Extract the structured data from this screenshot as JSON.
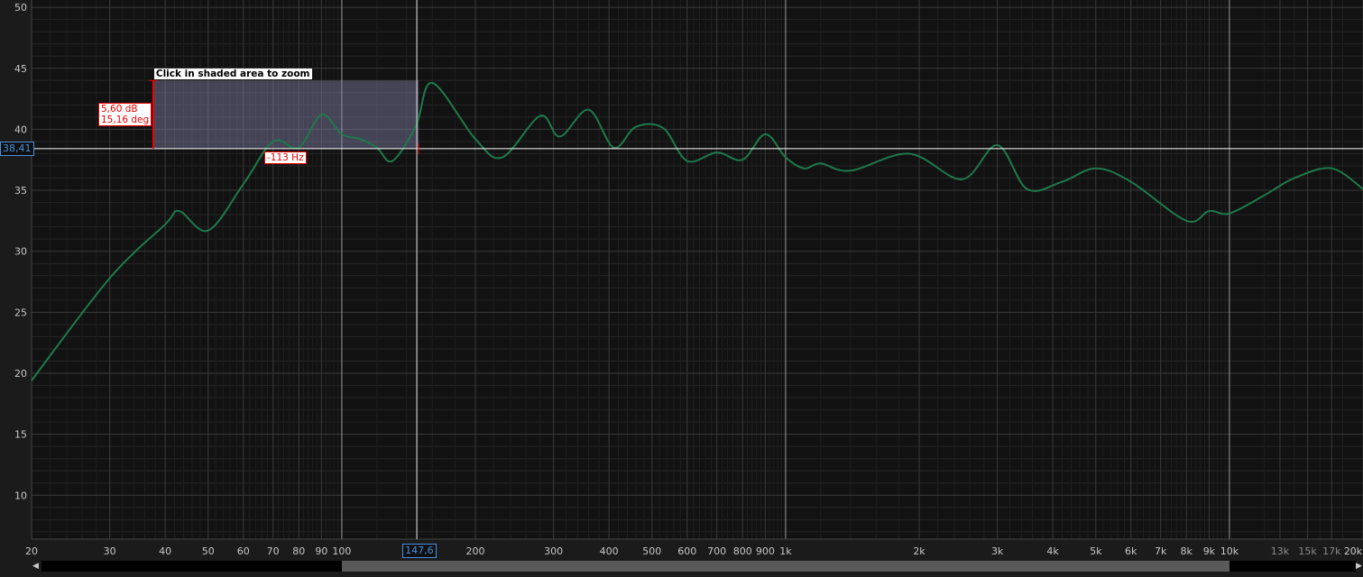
{
  "chart_data": {
    "type": "line",
    "x_scale": "log",
    "xlim": [
      20,
      20000
    ],
    "ylim": [
      6.4,
      50.6
    ],
    "grid": true,
    "y_ticks": [
      10,
      15,
      20,
      25,
      30,
      35,
      40,
      45,
      50
    ],
    "x_ticks": [
      {
        "v": 20,
        "label": "20"
      },
      {
        "v": 30,
        "label": "30"
      },
      {
        "v": 40,
        "label": "40"
      },
      {
        "v": 50,
        "label": "50"
      },
      {
        "v": 60,
        "label": "60"
      },
      {
        "v": 70,
        "label": "70"
      },
      {
        "v": 80,
        "label": "80"
      },
      {
        "v": 90,
        "label": "90"
      },
      {
        "v": 100,
        "label": "100"
      },
      {
        "v": 200,
        "label": "200"
      },
      {
        "v": 300,
        "label": "300"
      },
      {
        "v": 400,
        "label": "400"
      },
      {
        "v": 500,
        "label": "500"
      },
      {
        "v": 600,
        "label": "600"
      },
      {
        "v": 700,
        "label": "700"
      },
      {
        "v": 800,
        "label": "800"
      },
      {
        "v": 900,
        "label": "900"
      },
      {
        "v": 1000,
        "label": "1k"
      },
      {
        "v": 2000,
        "label": "2k"
      },
      {
        "v": 3000,
        "label": "3k"
      },
      {
        "v": 4000,
        "label": "4k"
      },
      {
        "v": 5000,
        "label": "5k"
      },
      {
        "v": 6000,
        "label": "6k"
      },
      {
        "v": 7000,
        "label": "7k"
      },
      {
        "v": 8000,
        "label": "8k"
      },
      {
        "v": 9000,
        "label": "9k"
      },
      {
        "v": 10000,
        "label": "10k"
      },
      {
        "v": 13000,
        "label": "13k",
        "dim": true
      },
      {
        "v": 15000,
        "label": "15k",
        "dim": true
      },
      {
        "v": 17000,
        "label": "17k",
        "dim": true
      },
      {
        "v": 20000,
        "label": "20k"
      }
    ],
    "series": [
      {
        "color": "#1e7a4a",
        "points": [
          [
            20,
            19.4
          ],
          [
            30,
            27.8
          ],
          [
            40,
            32.2
          ],
          [
            43,
            33.3
          ],
          [
            50,
            31.7
          ],
          [
            60,
            35.5
          ],
          [
            70,
            39.0
          ],
          [
            80,
            38.5
          ],
          [
            90,
            41.2
          ],
          [
            100,
            39.6
          ],
          [
            110,
            39.2
          ],
          [
            120,
            38.5
          ],
          [
            130,
            37.4
          ],
          [
            147,
            40.3
          ],
          [
            160,
            43.8
          ],
          [
            200,
            39.2
          ],
          [
            230,
            37.7
          ],
          [
            280,
            41.1
          ],
          [
            310,
            39.4
          ],
          [
            360,
            41.6
          ],
          [
            410,
            38.5
          ],
          [
            460,
            40.2
          ],
          [
            530,
            40.1
          ],
          [
            600,
            37.4
          ],
          [
            700,
            38.1
          ],
          [
            800,
            37.5
          ],
          [
            900,
            39.6
          ],
          [
            1000,
            37.7
          ],
          [
            1100,
            36.8
          ],
          [
            1200,
            37.2
          ],
          [
            1400,
            36.6
          ],
          [
            1900,
            38.0
          ],
          [
            2500,
            35.9
          ],
          [
            3000,
            38.7
          ],
          [
            3500,
            35.1
          ],
          [
            4200,
            35.7
          ],
          [
            5000,
            36.8
          ],
          [
            6000,
            35.7
          ],
          [
            8000,
            32.5
          ],
          [
            9000,
            33.3
          ],
          [
            10000,
            33.1
          ],
          [
            12000,
            34.6
          ],
          [
            14000,
            36.0
          ],
          [
            17000,
            36.8
          ],
          [
            20000,
            35.1
          ]
        ]
      }
    ],
    "cursor": {
      "freq": 147.6,
      "db": 38.41,
      "freq_label": "147,6",
      "db_label": "38,41"
    },
    "selection": {
      "f1": 37.6,
      "f2": 149,
      "db_top": 44.0,
      "db_bottom": 38.41,
      "hint": "Click in shaded area to zoom",
      "delta_db": "5,60 dB",
      "delta_phase": "15,16 deg",
      "delta_freq": "-113 Hz"
    }
  },
  "scrollbar": {
    "start_freq": 100,
    "end_freq": 10000
  }
}
